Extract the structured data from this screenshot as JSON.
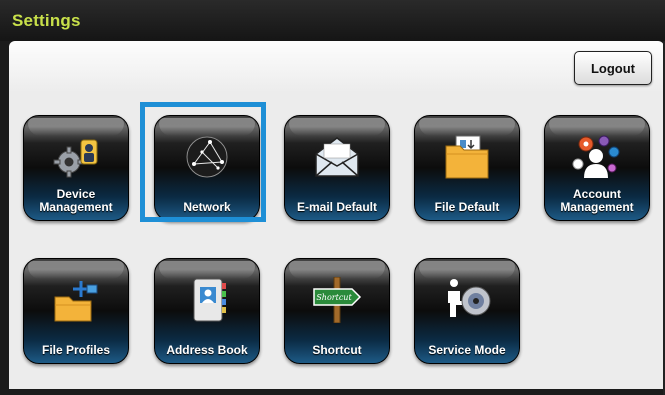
{
  "window": {
    "title": "Settings"
  },
  "toolbar": {
    "logout_label": "Logout"
  },
  "tiles": [
    {
      "label": "Device Management",
      "line1": "Device",
      "line2": "Management",
      "icon": "device-management-icon",
      "selected": false
    },
    {
      "label": "Network",
      "line1": "Network",
      "line2": "",
      "icon": "network-globe-icon",
      "selected": true
    },
    {
      "label": "E-mail Default",
      "line1": "E-mail Default",
      "line2": "",
      "icon": "envelope-icon",
      "selected": false
    },
    {
      "label": "File Default",
      "line1": "File Default",
      "line2": "",
      "icon": "folder-icon",
      "selected": false
    },
    {
      "label": "Account Management",
      "line1": "Account",
      "line2": "Management",
      "icon": "account-gears-icon",
      "selected": false
    },
    {
      "label": "File Profiles",
      "line1": "File Profiles",
      "line2": "",
      "icon": "file-profiles-icon",
      "selected": false
    },
    {
      "label": "Address Book",
      "line1": "Address Book",
      "line2": "",
      "icon": "address-book-icon",
      "selected": false
    },
    {
      "label": "Shortcut",
      "line1": "Shortcut",
      "line2": "",
      "icon": "shortcut-sign-icon",
      "selected": false,
      "sign_text": "Shortcut"
    },
    {
      "label": "Service Mode",
      "line1": "Service Mode",
      "line2": "",
      "icon": "service-mode-icon",
      "selected": false
    }
  ],
  "colors": {
    "title": "#c8e04a",
    "selection": "#1e8fd6",
    "tile_glow": "#1d5a86"
  }
}
